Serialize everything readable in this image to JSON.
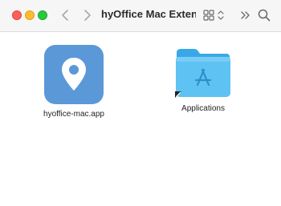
{
  "window": {
    "title": "hyOffice Mac Exten..."
  },
  "toolbar": {
    "back_icon": "chevron-left-icon",
    "forward_icon": "chevron-right-icon",
    "view_icon": "grid-view-icon",
    "more_icon": "double-chevron-right-icon",
    "search_icon": "search-icon"
  },
  "items": [
    {
      "label": "hyoffice-mac.app",
      "icon": "location-pin-icon",
      "color": "#5b98d8"
    },
    {
      "label": "Applications",
      "icon": "applications-folder-icon",
      "color": "#5ec2f3"
    }
  ],
  "colors": {
    "close": "#fe5f57",
    "minimize": "#febc2e",
    "zoom": "#28c840",
    "folder": "#5ec2f3"
  }
}
